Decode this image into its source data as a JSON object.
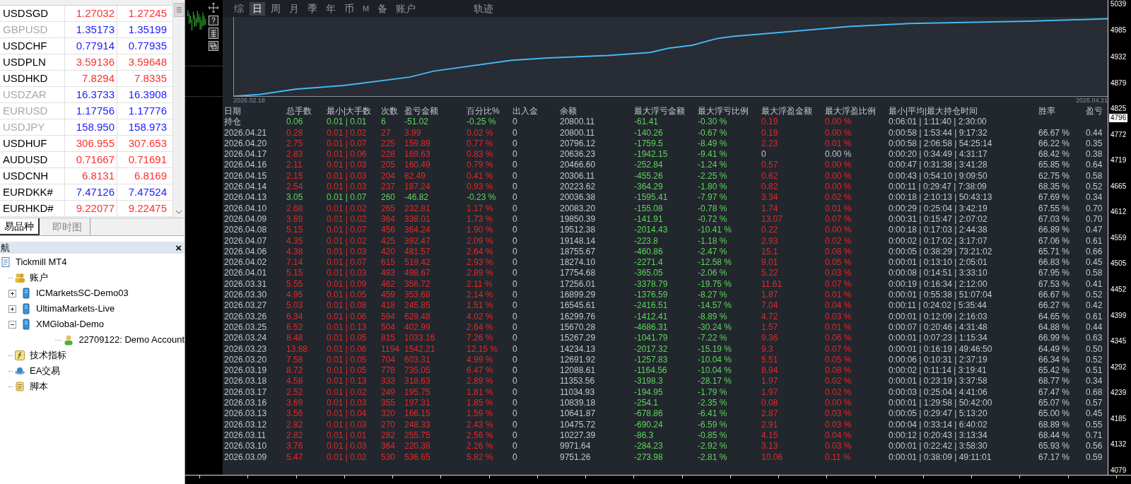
{
  "market_watch": {
    "rows": [
      {
        "symbol": "USDSGD",
        "bid": "1.27032",
        "ask": "1.27245",
        "rising": false,
        "dimmed": false
      },
      {
        "symbol": "GBPUSD",
        "bid": "1.35173",
        "ask": "1.35199",
        "rising": true,
        "dimmed": true
      },
      {
        "symbol": "USDCHF",
        "bid": "0.77914",
        "ask": "0.77935",
        "rising": true,
        "dimmed": false
      },
      {
        "symbol": "USDPLN",
        "bid": "3.59136",
        "ask": "3.59648",
        "rising": false,
        "dimmed": false
      },
      {
        "symbol": "USDHKD",
        "bid": "7.8294",
        "ask": "7.8335",
        "rising": false,
        "dimmed": false
      },
      {
        "symbol": "USDZAR",
        "bid": "16.3733",
        "ask": "16.3908",
        "rising": true,
        "dimmed": true
      },
      {
        "symbol": "EURUSD",
        "bid": "1.17756",
        "ask": "1.17776",
        "rising": true,
        "dimmed": true
      },
      {
        "symbol": "USDJPY",
        "bid": "158.950",
        "ask": "158.973",
        "rising": true,
        "dimmed": true
      },
      {
        "symbol": "USDHUF",
        "bid": "306.955",
        "ask": "307.653",
        "rising": false,
        "dimmed": false
      },
      {
        "symbol": "AUDUSD",
        "bid": "0.71667",
        "ask": "0.71691",
        "rising": false,
        "dimmed": false
      },
      {
        "symbol": "USDCNH",
        "bid": "6.8131",
        "ask": "6.8169",
        "rising": false,
        "dimmed": false
      },
      {
        "symbol": "EURDKK#",
        "bid": "7.47126",
        "ask": "7.47524",
        "rising": true,
        "dimmed": false
      },
      {
        "symbol": "EURHKD#",
        "bid": "9.22077",
        "ask": "9.22475",
        "rising": false,
        "dimmed": false
      }
    ]
  },
  "left_tabs": [
    {
      "label": "易品种",
      "selected": true
    },
    {
      "label": "即时图",
      "selected": false
    }
  ],
  "navigator": {
    "title": "航",
    "close": "×",
    "tree": [
      {
        "label": "Tickmill MT4",
        "kind": "terminal",
        "children": [
          {
            "label": "账户",
            "kind": "accounts",
            "children": [
              {
                "label": "ICMarketsSC-Demo03",
                "kind": "server",
                "expanded": false
              },
              {
                "label": "UltimaMarkets-Live",
                "kind": "server",
                "expanded": false
              },
              {
                "label": "XMGlobal-Demo",
                "kind": "server",
                "expanded": true,
                "children": [
                  {
                    "label": "22709122: Demo Account",
                    "kind": "account"
                  }
                ]
              }
            ]
          },
          {
            "label": "技术指标",
            "kind": "indicators"
          },
          {
            "label": "EA交易",
            "kind": "experts"
          },
          {
            "label": "脚本",
            "kind": "scripts"
          }
        ]
      }
    ]
  },
  "chart_tabs": [
    {
      "label": "综",
      "selected": false
    },
    {
      "label": "日",
      "selected": true
    },
    {
      "label": "周",
      "selected": false
    },
    {
      "label": "月",
      "selected": false
    },
    {
      "label": "季",
      "selected": false
    },
    {
      "label": "年",
      "selected": false
    },
    {
      "label": "币",
      "selected": false
    },
    {
      "label": "M",
      "selected": false
    },
    {
      "label": "备",
      "selected": false
    },
    {
      "label": "账户",
      "selected": false
    }
  ],
  "trace_tab": {
    "label": "轨迹",
    "selected": false
  },
  "equity_chart": {
    "start_label": "2026.02.18",
    "end_label": "2026.04.21"
  },
  "price_axis": {
    "upper": [
      "5039",
      "4985",
      "4932",
      "4879"
    ],
    "lower": [
      "4825",
      "4772",
      "4719",
      "4665",
      "4612",
      "4559",
      "4505",
      "4452",
      "4399",
      "4345",
      "4292",
      "4239",
      "4185",
      "4132",
      "4079"
    ],
    "current": "4796"
  },
  "table": {
    "columns": [
      "日期",
      "总手数",
      "最小|大手数",
      "次数",
      "盈亏金额",
      "百分比%",
      "出入金",
      "余额",
      "最大浮亏金额",
      "最大浮亏比例",
      "最大浮盈金额",
      "最大浮盈比例",
      "最小|平均|最大持仓时间",
      "胜率",
      "盈亏"
    ],
    "rows": [
      {
        "kind": "loss",
        "float_gain": true,
        "cells": [
          "持仓",
          "0.06",
          "0.01 | 0.01",
          "6",
          "-51.02",
          "-0.25 %",
          "0",
          "20800.11",
          "-61.41",
          "-0.30 %",
          "0.19",
          "0.00 %",
          "0:06:01 | 1:11:40 | 2:30:00"
        ]
      },
      {
        "kind": "gain",
        "float_gain": true,
        "cells": [
          "2026.04.21",
          "0.28",
          "0.01 | 0.02",
          "27",
          "3.99",
          "0.02 %",
          "0",
          "20800.11",
          "-140.26",
          "-0.67 %",
          "0.19",
          "0.00 %",
          "0:00:58 | 1:53:44 | 9:17:32",
          "66.67 %",
          "0.44"
        ]
      },
      {
        "kind": "gain",
        "float_gain": true,
        "cells": [
          "2026.04.20",
          "2.75",
          "0.01 | 0.07",
          "225",
          "159.89",
          "0.77 %",
          "0",
          "20796.12",
          "-1759.5",
          "-8.49 %",
          "2.23",
          "0.01 %",
          "0:00:58 | 2:06:58 | 54:25:14",
          "66.22 %",
          "0.35"
        ]
      },
      {
        "kind": "gain",
        "float_gain": false,
        "cells": [
          "2026.04.17",
          "2.83",
          "0.01 | 0.06",
          "228",
          "169.63",
          "0.83 %",
          "0",
          "20636.23",
          "-1942.15",
          "-9.41 %",
          "0",
          "0.00 %",
          "0:00:20 | 0:34:49 | 4:31:17",
          "68.42 %",
          "0.38"
        ]
      },
      {
        "kind": "gain",
        "float_gain": true,
        "cells": [
          "2026.04.16",
          "2.11",
          "0.01 | 0.03",
          "205",
          "160.49",
          "0.79 %",
          "0",
          "20466.60",
          "-252.84",
          "-1.24 %",
          "0.57",
          "0.00 %",
          "0:00:47 | 0:31:38 | 3:41:28",
          "65.85 %",
          "0.64"
        ]
      },
      {
        "kind": "gain",
        "float_gain": true,
        "cells": [
          "2026.04.15",
          "2.15",
          "0.01 | 0.03",
          "204",
          "82.49",
          "0.41 %",
          "0",
          "20306.11",
          "-455.26",
          "-2.25 %",
          "0.62",
          "0.00 %",
          "0:00:43 | 0:54:10 | 9:09:50",
          "62.75 %",
          "0.58"
        ]
      },
      {
        "kind": "gain",
        "float_gain": true,
        "cells": [
          "2026.04.14",
          "2.54",
          "0.01 | 0.03",
          "237",
          "187.24",
          "0.93 %",
          "0",
          "20223.62",
          "-364.29",
          "-1.80 %",
          "0.82",
          "0.00 %",
          "0:00:11 | 0:29:47 | 7:38:09",
          "68.35 %",
          "0.52"
        ]
      },
      {
        "kind": "loss",
        "float_gain": true,
        "cells": [
          "2026.04.13",
          "3.05",
          "0.01 | 0.07",
          "260",
          "-46.82",
          "-0.23 %",
          "0",
          "20036.38",
          "-1595.41",
          "-7.97 %",
          "3.34",
          "0.02 %",
          "0:00:18 | 2:10:13 | 50:43:13",
          "67.69 %",
          "0.34"
        ]
      },
      {
        "kind": "gain",
        "float_gain": true,
        "cells": [
          "2026.04.10",
          "2.68",
          "0.01 | 0.02",
          "265",
          "232.81",
          "1.17 %",
          "0",
          "20083.20",
          "-155.08",
          "-0.78 %",
          "1.74",
          "0.01 %",
          "0:00:29 | 0:25:04 | 3:42:19",
          "67.55 %",
          "0.70"
        ]
      },
      {
        "kind": "gain",
        "float_gain": true,
        "cells": [
          "2026.04.09",
          "3.69",
          "0.01 | 0.02",
          "364",
          "338.01",
          "1.73 %",
          "0",
          "19850.39",
          "-141.91",
          "-0.72 %",
          "13.07",
          "0.07 %",
          "0:00:31 | 0:15:47 | 2:07:02",
          "67.03 %",
          "0.70"
        ]
      },
      {
        "kind": "gain",
        "float_gain": true,
        "cells": [
          "2026.04.08",
          "5.15",
          "0.01 | 0.07",
          "456",
          "364.24",
          "1.90 %",
          "0",
          "19512.38",
          "-2014.43",
          "-10.41 %",
          "0.22",
          "0.00 %",
          "0:00:18 | 0:17:03 | 2:44:38",
          "66.89 %",
          "0.47"
        ]
      },
      {
        "kind": "gain",
        "float_gain": true,
        "cells": [
          "2026.04.07",
          "4.35",
          "0.01 | 0.02",
          "425",
          "392.47",
          "2.09 %",
          "0",
          "19148.14",
          "-223.8",
          "-1.18 %",
          "2.93",
          "0.02 %",
          "0:00:02 | 0:17:02 | 3:17:07",
          "67.06 %",
          "0.61"
        ]
      },
      {
        "kind": "gain",
        "float_gain": true,
        "cells": [
          "2026.04.06",
          "4.38",
          "0.01 | 0.03",
          "420",
          "481.57",
          "2.64 %",
          "0",
          "18755.67",
          "-460.86",
          "-2.47 %",
          "15.1",
          "0.08 %",
          "0:00:05 | 0:38:29 | 73:21:02",
          "65.71 %",
          "0.66"
        ]
      },
      {
        "kind": "gain",
        "float_gain": true,
        "cells": [
          "2026.04.02",
          "7.14",
          "0.01 | 0.07",
          "615",
          "519.42",
          "2.93 %",
          "0",
          "18274.10",
          "-2271.4",
          "-12.58 %",
          "9.01",
          "0.05 %",
          "0:00:01 | 0:13:10 | 2:05:01",
          "66.83 %",
          "0.45"
        ]
      },
      {
        "kind": "gain",
        "float_gain": true,
        "cells": [
          "2026.04.01",
          "5.15",
          "0.01 | 0.03",
          "493",
          "498.67",
          "2.89 %",
          "0",
          "17754.68",
          "-365.05",
          "-2.06 %",
          "5.22",
          "0.03 %",
          "0:00:08 | 0:14:51 | 3:33:10",
          "67.95 %",
          "0.58"
        ]
      },
      {
        "kind": "gain",
        "float_gain": true,
        "cells": [
          "2026.03.31",
          "5.55",
          "0.01 | 0.09",
          "462",
          "356.72",
          "2.11 %",
          "0",
          "17256.01",
          "-3378.79",
          "-19.75 %",
          "11.61",
          "0.07 %",
          "0:00:19 | 0:16:34 | 2:12:00",
          "67.53 %",
          "0.41"
        ]
      },
      {
        "kind": "gain",
        "float_gain": true,
        "cells": [
          "2026.03.30",
          "4.95",
          "0.01 | 0.05",
          "459",
          "353.68",
          "2.14 %",
          "0",
          "16899.29",
          "-1376.59",
          "-8.27 %",
          "1.87",
          "0.01 %",
          "0:00:01 | 0:55:38 | 51:07:04",
          "66.67 %",
          "0.52"
        ]
      },
      {
        "kind": "gain",
        "float_gain": true,
        "cells": [
          "2026.03.27",
          "5.03",
          "0.01 | 0.08",
          "418",
          "245.85",
          "1.51 %",
          "0",
          "16545.61",
          "-2416.51",
          "-14.57 %",
          "7.04",
          "0.04 %",
          "0:00:11 | 0:24:02 | 5:35:44",
          "66.27 %",
          "0.42"
        ]
      },
      {
        "kind": "gain",
        "float_gain": true,
        "cells": [
          "2026.03.26",
          "6.34",
          "0.01 | 0.06",
          "594",
          "629.48",
          "4.02 %",
          "0",
          "16299.76",
          "-1412.41",
          "-8.89 %",
          "4.72",
          "0.03 %",
          "0:00:01 | 0:12:09 | 2:16:03",
          "64.65 %",
          "0.61"
        ]
      },
      {
        "kind": "gain",
        "float_gain": true,
        "cells": [
          "2026.03.25",
          "6.52",
          "0.01 | 0.13",
          "504",
          "402.99",
          "2.64 %",
          "0",
          "15670.28",
          "-4686.31",
          "-30.24 %",
          "1.57",
          "0.01 %",
          "0:00:07 | 0:20:46 | 4:31:48",
          "64.88 %",
          "0.44"
        ]
      },
      {
        "kind": "gain",
        "float_gain": true,
        "cells": [
          "2026.03.24",
          "8.48",
          "0.01 | 0.05",
          "815",
          "1033.16",
          "7.26 %",
          "0",
          "15267.29",
          "-1041.79",
          "-7.22 %",
          "9.36",
          "0.06 %",
          "0:00:01 | 0:07:23 | 1:15:34",
          "66.99 %",
          "0.63"
        ]
      },
      {
        "kind": "gain",
        "float_gain": true,
        "cells": [
          "2026.03.23",
          "13.88",
          "0.01 | 0.06",
          "1194",
          "1542.21",
          "12.15 %",
          "0",
          "14234.13",
          "-2017.32",
          "-15.19 %",
          "9.3",
          "0.07 %",
          "0:00:01 | 0:16:19 | 49:46:50",
          "64.49 %",
          "0.50"
        ]
      },
      {
        "kind": "gain",
        "float_gain": true,
        "cells": [
          "2026.03.20",
          "7.58",
          "0.01 | 0.05",
          "704",
          "603.31",
          "4.99 %",
          "0",
          "12691.92",
          "-1257.83",
          "-10.04 %",
          "5.51",
          "0.05 %",
          "0:00:06 | 0:10:31 | 2:37:19",
          "66.34 %",
          "0.52"
        ]
      },
      {
        "kind": "gain",
        "float_gain": true,
        "cells": [
          "2026.03.19",
          "8.72",
          "0.01 | 0.05",
          "778",
          "735.05",
          "6.47 %",
          "0",
          "12088.61",
          "-1164.56",
          "-10.04 %",
          "8.94",
          "0.08 %",
          "0:00:02 | 0:11:14 | 3:19:41",
          "65.42 %",
          "0.51"
        ]
      },
      {
        "kind": "gain",
        "float_gain": true,
        "cells": [
          "2026.03.18",
          "4.58",
          "0.01 | 0.13",
          "333",
          "318.63",
          "2.89 %",
          "0",
          "11353.56",
          "-3198.3",
          "-28.17 %",
          "1.97",
          "0.02 %",
          "0:00:01 | 0:23:19 | 3:37:58",
          "68.77 %",
          "0.34"
        ]
      },
      {
        "kind": "gain",
        "float_gain": true,
        "cells": [
          "2026.03.17",
          "2.52",
          "0.01 | 0.02",
          "249",
          "195.75",
          "1.81 %",
          "0",
          "11034.93",
          "-194.95",
          "-1.79 %",
          "1.97",
          "0.02 %",
          "0:00:03 | 0:25:04 | 4:41:06",
          "67.47 %",
          "0.68"
        ]
      },
      {
        "kind": "gain",
        "float_gain": true,
        "cells": [
          "2026.03.16",
          "3.69",
          "0.01 | 0.03",
          "355",
          "197.31",
          "1.85 %",
          "0",
          "10839.18",
          "-254.1",
          "-2.35 %",
          "0.08",
          "0.00 %",
          "0:00:01 | 1:29:58 | 50:42:00",
          "65.07 %",
          "0.57"
        ]
      },
      {
        "kind": "gain",
        "float_gain": true,
        "cells": [
          "2026.03.13",
          "3.56",
          "0.01 | 0.04",
          "320",
          "166.15",
          "1.59 %",
          "0",
          "10641.87",
          "-678.86",
          "-6.41 %",
          "2.87",
          "0.03 %",
          "0:00:05 | 0:29:47 | 5:13:20",
          "65.00 %",
          "0.45"
        ]
      },
      {
        "kind": "gain",
        "float_gain": true,
        "cells": [
          "2026.03.12",
          "2.82",
          "0.01 | 0.03",
          "270",
          "248.33",
          "2.43 %",
          "0",
          "10475.72",
          "-690.24",
          "-6.59 %",
          "2.91",
          "0.03 %",
          "0:00:04 | 0:33:14 | 6:40:02",
          "68.89 %",
          "0.55"
        ]
      },
      {
        "kind": "gain",
        "float_gain": true,
        "cells": [
          "2026.03.11",
          "2.82",
          "0.01 | 0.01",
          "282",
          "255.75",
          "2.56 %",
          "0",
          "10227.39",
          "-86.3",
          "-0.85 %",
          "4.15",
          "0.04 %",
          "0:00:12 | 0:20:43 | 3:13:34",
          "68.44 %",
          "0.71"
        ]
      },
      {
        "kind": "gain",
        "float_gain": true,
        "cells": [
          "2026.03.10",
          "3.76",
          "0.01 | 0.03",
          "364",
          "220.38",
          "2.26 %",
          "0",
          "9971.64",
          "-284.23",
          "-2.92 %",
          "3.13",
          "0.03 %",
          "0:00:01 | 0:22:42 | 3:58:30",
          "65.93 %",
          "0.56"
        ]
      },
      {
        "kind": "gain",
        "float_gain": true,
        "cells": [
          "2026.03.09",
          "5.47",
          "0.01 | 0.02",
          "530",
          "536.65",
          "5.82 %",
          "0",
          "9751.26",
          "-273.98",
          "-2.81 %",
          "10.06",
          "0.11 %",
          "0:00:01 | 0:38:09 | 49:11:01",
          "67.17 %",
          "0.59"
        ]
      }
    ]
  }
}
